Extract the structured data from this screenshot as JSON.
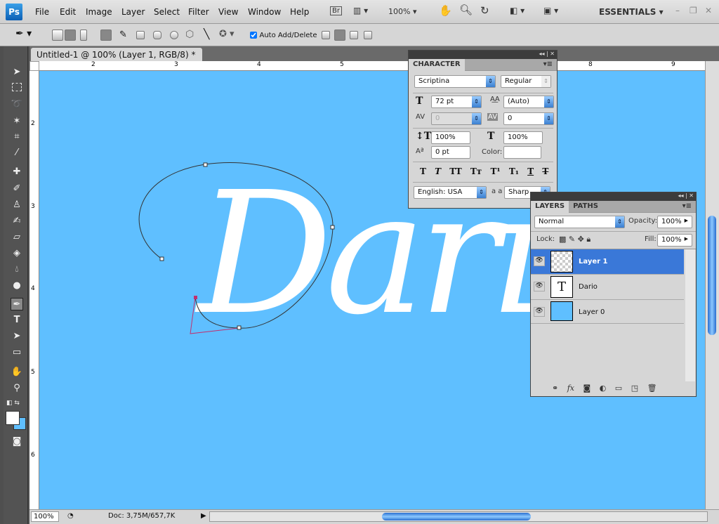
{
  "app": {
    "logo": "Ps",
    "menus": [
      "File",
      "Edit",
      "Image",
      "Layer",
      "Select",
      "Filter",
      "View",
      "Window",
      "Help"
    ],
    "bridge": "Br",
    "zoom": "100%",
    "workspace": "ESSENTIALS"
  },
  "options": {
    "auto_add_delete": "Auto Add/Delete",
    "auto_add_checked": true
  },
  "document": {
    "tab_title": "Untitled-1 @ 100% (Layer 1, RGB/8) *",
    "canvas_color": "#5fbfff",
    "text": "Dario"
  },
  "rulers": {
    "h": [
      "2",
      "3",
      "4",
      "5",
      "8",
      "9"
    ],
    "v": [
      "2",
      "3",
      "4",
      "5",
      "6"
    ]
  },
  "status": {
    "zoom": "100%",
    "doc": "Doc: 3,75M/657,7K"
  },
  "character": {
    "title": "CHARACTER",
    "font": "Scriptina",
    "style": "Regular",
    "size": "72 pt",
    "leading": "(Auto)",
    "kerning": "0",
    "tracking": "0",
    "vscale": "100%",
    "hscale": "100%",
    "baseline": "0 pt",
    "color_label": "Color:",
    "language": "English: USA",
    "aa_label": "a a",
    "antialias": "Sharp",
    "styles": [
      "T",
      "T",
      "TT",
      "Tт",
      "T¹",
      "T₁",
      "T",
      "T"
    ]
  },
  "layers": {
    "tabs": [
      "LAYERS",
      "PATHS"
    ],
    "blend": "Normal",
    "opacity_label": "Opacity:",
    "opacity": "100%",
    "lock_label": "Lock:",
    "fill_label": "Fill:",
    "fill": "100%",
    "items": [
      {
        "name": "Layer 1",
        "selected": true
      },
      {
        "name": "Dario",
        "thumb": "T"
      },
      {
        "name": "Layer 0"
      }
    ]
  }
}
